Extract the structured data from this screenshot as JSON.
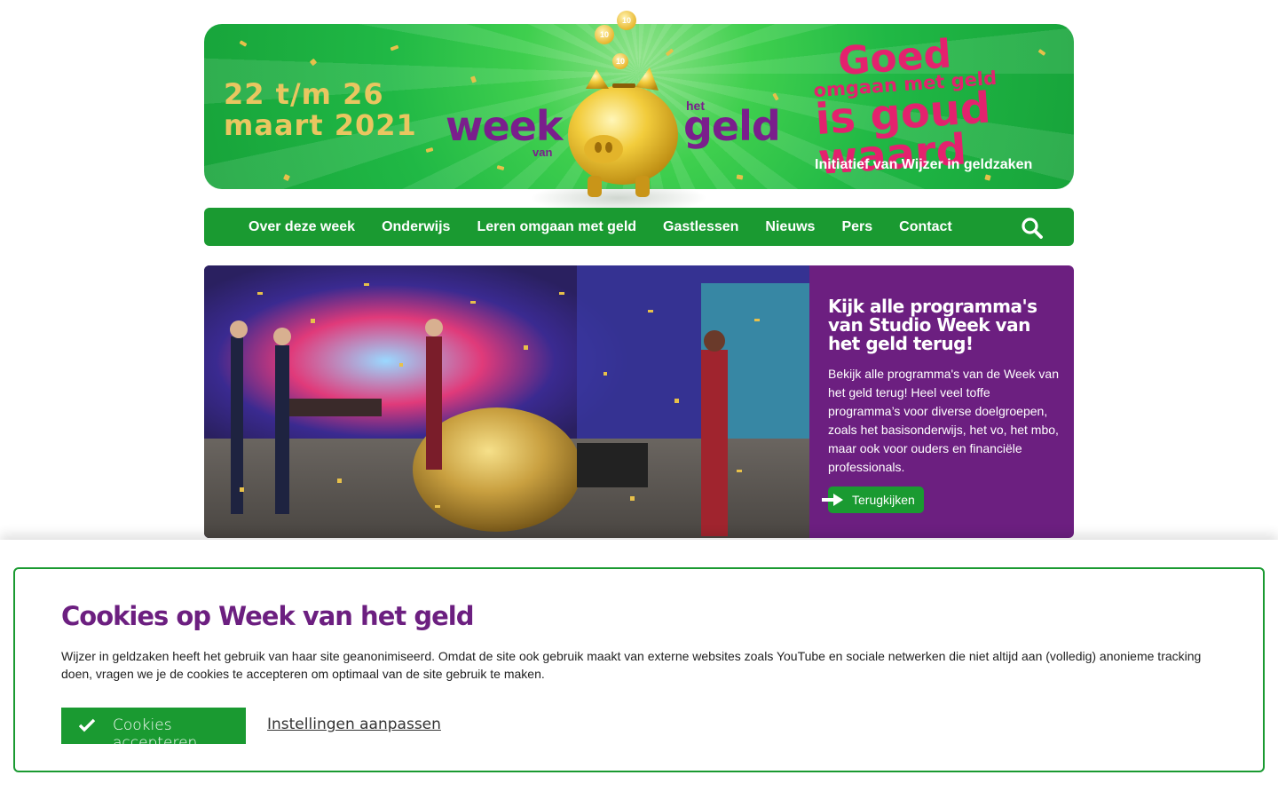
{
  "banner": {
    "date_line1": "22 t/m 26",
    "date_line2": "maart 2021",
    "logo_week": "week",
    "logo_van": "van",
    "logo_het": "het",
    "logo_geld": "geld",
    "slogan_line1": "Goed",
    "slogan_line2": "omgaan met geld",
    "slogan_line3": "is goud waard",
    "initiatief": "Initiatief van  Wijzer in geldzaken",
    "coin_label": "10"
  },
  "nav": {
    "items": [
      "Over deze week",
      "Onderwijs",
      "Leren omgaan met geld",
      "Gastlessen",
      "Nieuws",
      "Pers",
      "Contact"
    ],
    "search_icon": "search-icon"
  },
  "hero": {
    "title": "Kijk alle programma's van Studio Week van het geld terug!",
    "description": "Bekijk alle programma's van de Week van het geld terug! Heel veel toffe programma’s voor diverse doelgroepen, zoals het basisonderwijs, het vo, het mbo, maar ook voor ouders en financiële professionals.",
    "button_label": "Terugkijken"
  },
  "cookie": {
    "title": "Cookies op Week van het geld",
    "text": "Wijzer in geldzaken heeft het gebruik van haar site geanonimiseerd. Omdat de site ook gebruik maakt van externe websites zoals YouTube en sociale netwerken die niet altijd aan (volledig) anonieme tracking doen, vragen we je de cookies te accepteren om optimaal van de site gebruik te maken.",
    "accept_label": "Cookies accepteren",
    "settings_label": "Instellingen aanpassen"
  },
  "colors": {
    "brand_green": "#1a9a31",
    "brand_purple": "#6c1f80",
    "slogan_pink": "#e3226e",
    "gold": "#e9c660"
  }
}
